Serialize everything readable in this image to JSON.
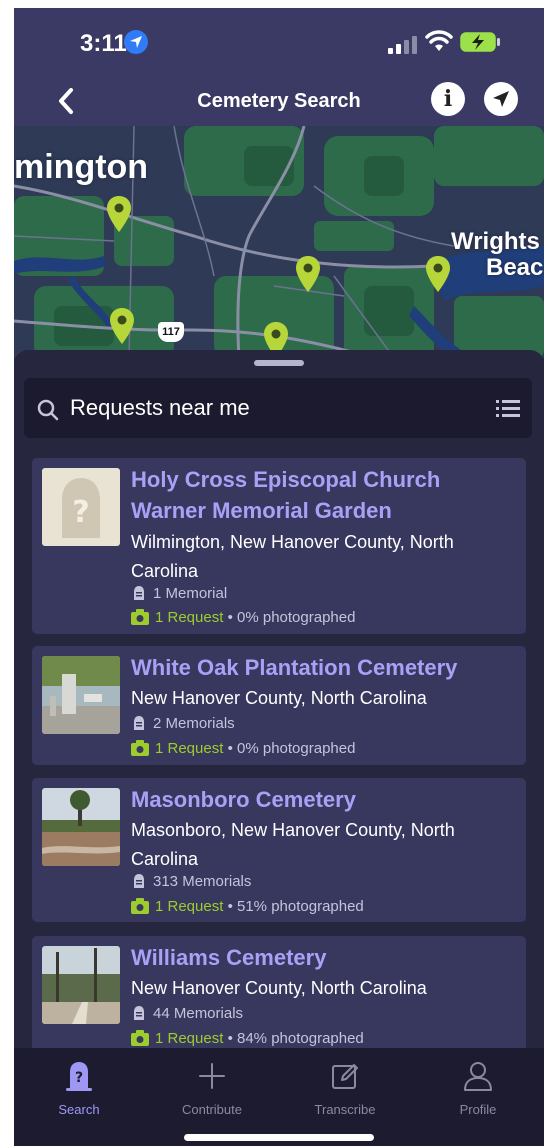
{
  "status": {
    "time": "3:11"
  },
  "nav": {
    "title": "Cemetery Search",
    "back_icon": "chevron-left-icon",
    "info_icon": "info-icon",
    "locate_icon": "location-arrow-icon"
  },
  "map": {
    "labels": {
      "city": "mington",
      "wrights": "Wrights",
      "beach": "Beac"
    },
    "route_shield": "117"
  },
  "search": {
    "text": "Requests near me",
    "search_icon": "magnifier-icon",
    "list_icon": "list-icon"
  },
  "cemeteries": [
    {
      "title": "Holy Cross Episcopal Church Warner Memorial Garden",
      "location": "Wilmington, New Hanover County, North Carolina",
      "memorials": "1 Memorial",
      "requests": "1 Request",
      "photographed": "0% photographed"
    },
    {
      "title": "White Oak Plantation Cemetery",
      "location": "New Hanover County, North Carolina",
      "memorials": "2 Memorials",
      "requests": "1 Request",
      "photographed": "0% photographed"
    },
    {
      "title": "Masonboro Cemetery",
      "location": "Masonboro, New Hanover County, North Carolina",
      "memorials": "313 Memorials",
      "requests": "1 Request",
      "photographed": "51% photographed"
    },
    {
      "title": "Williams Cemetery",
      "location": "New Hanover County, North Carolina",
      "memorials": "44 Memorials",
      "requests": "1 Request",
      "photographed": "84% photographed"
    }
  ],
  "separator": "•",
  "tabs": [
    {
      "label": "Search",
      "icon": "search-tombstone-icon",
      "active": true
    },
    {
      "label": "Contribute",
      "icon": "plus-icon",
      "active": false
    },
    {
      "label": "Transcribe",
      "icon": "edit-icon",
      "active": false
    },
    {
      "label": "Profile",
      "icon": "person-icon",
      "active": false
    }
  ],
  "colors": {
    "accent": "#a8a2f7",
    "request_green": "#9ccd2c",
    "background": "#27263f",
    "header": "#3b3a64"
  }
}
